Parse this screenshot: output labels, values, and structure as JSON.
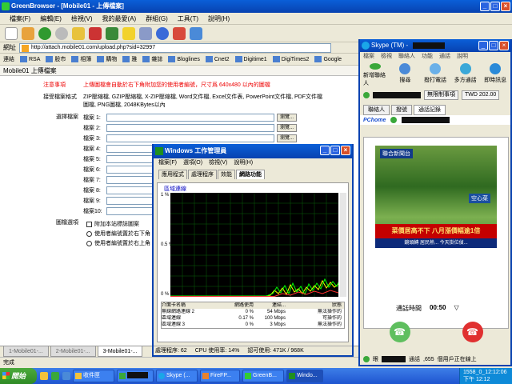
{
  "browser": {
    "title": "GreenBrowser - [Mobile01 - 上傳檔案]",
    "menu": [
      "檔案(F)",
      "編輯(E)",
      "檢視(V)",
      "我的最愛(A)",
      "群組(G)",
      "工具(T)",
      "說明(H)"
    ],
    "address_label": "網址",
    "address": "http://attach.mobile01.com/upload.php?sid=32997",
    "links_label": "連結",
    "links": [
      "RSA",
      "股市",
      "相簿",
      "購物",
      "雅",
      "雜誌",
      "Bloglines",
      "Cnet2",
      "Digitime1",
      "DigiTimes2",
      "Google"
    ],
    "page_tab": "Mobile01 上傳檔案",
    "bottom_tabs": [
      "1-Mobile01-...",
      "2-Mobile01-...",
      "3-Mobile01-..."
    ],
    "status": "完成"
  },
  "page": {
    "notice_label": "注意事項",
    "notice_text": "上傳圖檔會自動於右下角附加您的使用者編號，尺寸爲 640x480 以內的圖檔",
    "format_label": "接受檔案格式",
    "format_text1": "ZIP壓縮檔, GZIP壓縮檔, X-ZIP壓縮檔, Word文件檔, Excel文件表, PowerPoint文件檔, PDF文件檔",
    "format_text2": "圖檔, PNG圖檔, 2048KBytes以內",
    "choose_label": "選擇檔案",
    "files": [
      "檔案 1:",
      "檔案 2:",
      "檔案 3:",
      "檔案 4:",
      "檔案 5:",
      "檔案 6:",
      "檔案 7:",
      "檔案 8:",
      "檔案 9:",
      "檔案10:"
    ],
    "browse_label": "瀏覽...",
    "image_opts_label": "圖檔選項",
    "opt1": "附加本站標誌圖案",
    "opt2": "使用者編號置於右下角",
    "opt3": "使用者編號置於右上角"
  },
  "taskmgr": {
    "title": "Windows 工作管理員",
    "menu": [
      "檔案(F)",
      "選項(O)",
      "檢視(V)",
      "說明(H)"
    ],
    "tabs": [
      "應用程式",
      "處理程序",
      "效能",
      "網路功能"
    ],
    "graph_title": "區域連線",
    "y_labels": [
      "1 %",
      "0.5 %",
      "0 %"
    ],
    "table_headers": [
      "介面卡名稱",
      "網路使用",
      "連結...",
      "狀態"
    ],
    "rows": [
      [
        "無線網路連線 2",
        "0 %",
        "54 Mbps",
        "無法操作的"
      ],
      [
        "區域連線",
        "0.17 %",
        "100 Mbps",
        "可操作的"
      ],
      [
        "區域連線 3",
        "0 %",
        "3 Mbps",
        "無法操作的"
      ]
    ],
    "status": [
      "處理程序: 62",
      "CPU 使用率: 14%",
      "認可使用: 471K / 968K"
    ]
  },
  "skype": {
    "title": "Skype (TM) -",
    "menu": [
      "檔案",
      "檢視",
      "聯絡人",
      "功能",
      "通話",
      "說明"
    ],
    "tools": [
      "新增聯絡人",
      "搜尋",
      "撥打電話",
      "多方通話",
      "即時訊息"
    ],
    "online_status": "無限制事項",
    "credit": "TWD 202.00",
    "tabs": [
      "聯絡人",
      "撥號",
      "通話記錄"
    ],
    "pchome": "PChome",
    "video_logo": "聯合新聞台",
    "video_tag": "空心菜",
    "banner": "菜價居高不下 八月漲價幅逾1倍",
    "ticker": "鏡頭轉 居民熱... 今天掛位偵...",
    "time_label": "通話時間",
    "time": "00:50",
    "footer_text": "眼",
    "footer_text2": "通話",
    "footer_count": ",655",
    "footer_online": "個用戶正在線上"
  },
  "taskbar": {
    "start": "開始",
    "tasks": [
      "收件匣",
      "",
      "Skype (...",
      "FireFP...",
      "GreenB...",
      "Windo..."
    ],
    "tray_date": "1558_0_12:12:06",
    "tray_time": "下午 12:12"
  },
  "colors": {
    "title_blue": "#0842b0",
    "red_notice": "#e00000",
    "graph_green": "#00ff00"
  }
}
